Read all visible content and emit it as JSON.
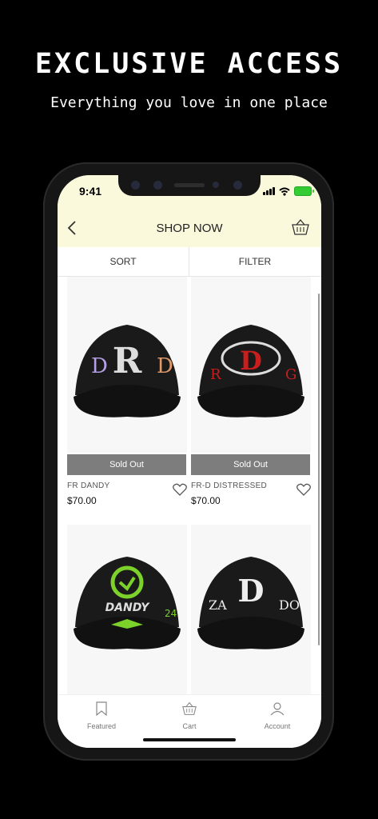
{
  "promo": {
    "headline": "EXCLUSIVE ACCESS",
    "subline": "Everything you love in one place"
  },
  "status": {
    "time": "9:41"
  },
  "nav": {
    "title": "SHOP NOW",
    "back_icon": "chevron-left-icon",
    "cart_icon": "basket-icon"
  },
  "sortbar": {
    "sort_label": "SORT",
    "filter_label": "FILTER"
  },
  "products": [
    {
      "name": "FR DANDY",
      "price": "$70.00",
      "status": "Sold Out"
    },
    {
      "name": "FR-D DISTRESSED",
      "price": "$70.00",
      "status": "Sold Out"
    },
    {
      "name": "",
      "price": "",
      "status": ""
    },
    {
      "name": "",
      "price": "",
      "status": ""
    }
  ],
  "tabs": [
    {
      "label": "Featured",
      "icon": "bookmark-icon"
    },
    {
      "label": "Cart",
      "icon": "basket-icon"
    },
    {
      "label": "Account",
      "icon": "user-icon"
    }
  ],
  "colors": {
    "header_bg": "#fbf9dc",
    "soldout_bg": "#7d7d7d",
    "accent_green": "#7cd12a",
    "accent_red": "#c81e1e"
  }
}
